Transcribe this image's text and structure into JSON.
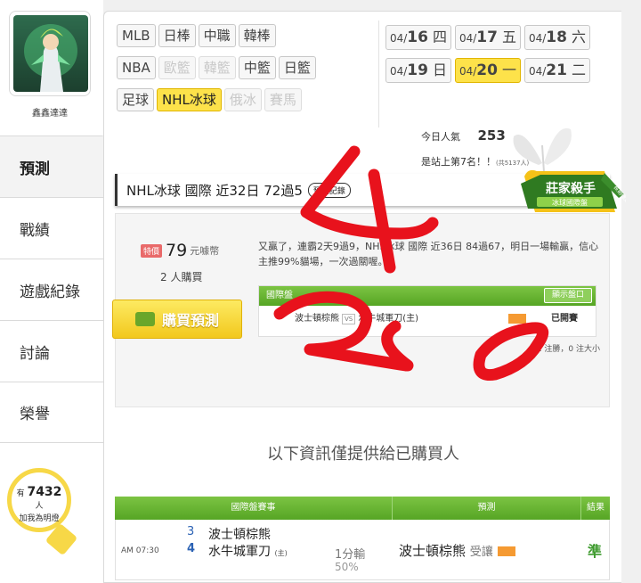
{
  "user": {
    "name": "鑫鑫達達",
    "avatar_icon": "avatar-image"
  },
  "sidebar": {
    "items": [
      {
        "label": "預測",
        "active": true
      },
      {
        "label": "戰績",
        "active": false
      },
      {
        "label": "遊戲紀錄",
        "active": false
      },
      {
        "label": "討論",
        "active": false
      },
      {
        "label": "榮譽",
        "active": false
      }
    ],
    "fans": {
      "prefix": "有",
      "count": "7432",
      "suffix": "人",
      "line2": "加我為明燈"
    }
  },
  "sports": [
    {
      "label": "MLB",
      "state": "normal"
    },
    {
      "label": "日棒",
      "state": "normal"
    },
    {
      "label": "中職",
      "state": "normal"
    },
    {
      "label": "韓棒",
      "state": "normal"
    },
    {
      "label": "NBA",
      "state": "normal"
    },
    {
      "label": "歐籃",
      "state": "disabled"
    },
    {
      "label": "韓籃",
      "state": "disabled"
    },
    {
      "label": "中籃",
      "state": "normal"
    },
    {
      "label": "日籃",
      "state": "normal"
    },
    {
      "label": "足球",
      "state": "normal"
    },
    {
      "label": "NHL冰球",
      "state": "active"
    },
    {
      "label": "俄冰",
      "state": "disabled"
    },
    {
      "label": "賽馬",
      "state": "disabled"
    }
  ],
  "dates": [
    {
      "md": "04/",
      "d": "16",
      "wd": " 四",
      "active": false
    },
    {
      "md": "04/",
      "d": "17",
      "wd": " 五",
      "active": false
    },
    {
      "md": "04/",
      "d": "18",
      "wd": " 六",
      "active": false
    },
    {
      "md": "04/",
      "d": "19",
      "wd": " 日",
      "active": false
    },
    {
      "md": "04/",
      "d": "20",
      "wd": " 一",
      "active": true
    },
    {
      "md": "04/",
      "d": "21",
      "wd": " 二",
      "active": false
    }
  ],
  "stats": {
    "popularity_label": "今日人氣",
    "popularity_value": "253",
    "rank_text": "是站上第7名！！",
    "rank_small": "(共5137人)"
  },
  "title_bar": {
    "text": "NHL冰球 國際 近32日 72過5",
    "record_button": "預測記錄"
  },
  "badge": {
    "main": "莊家殺手",
    "sub": "冰球國際盤",
    "ribbon": "長期穩定"
  },
  "purchase": {
    "special_tag": "特價",
    "price": "79",
    "unit": "元噱幣",
    "buyers": "2 人購買",
    "buy_button": "購買預測",
    "description": "又贏了，連霸2天9過9，NHL冰球 國際 近36日 84過67，明日一場輸贏，信心主推99%貓場，一次過關喔。",
    "market": {
      "header": "國際盤",
      "show_button": "顯示盤口",
      "team1": "波士頓棕熊",
      "vs": "VS",
      "team2": "水牛城軍刀(主)",
      "status": "已開賽"
    },
    "stats_line": "1 注勝，0 注大小"
  },
  "info_note": "以下資訊僅提供給已購買人",
  "table": {
    "headers": [
      "國際盤賽事",
      "預測",
      "結果"
    ],
    "rows": [
      {
        "time": "AM 07:30",
        "score1": "3",
        "score2": "4",
        "team1": "波士頓棕熊",
        "team2": "水牛城軍刀",
        "team2_mark": "(主)",
        "line": "1分輸",
        "pct": "50%",
        "pick": "波士頓棕熊",
        "pick_suffix": "受讓",
        "result": "準"
      }
    ]
  },
  "annotation": {
    "text": "4 20",
    "color": "#e8121c"
  }
}
